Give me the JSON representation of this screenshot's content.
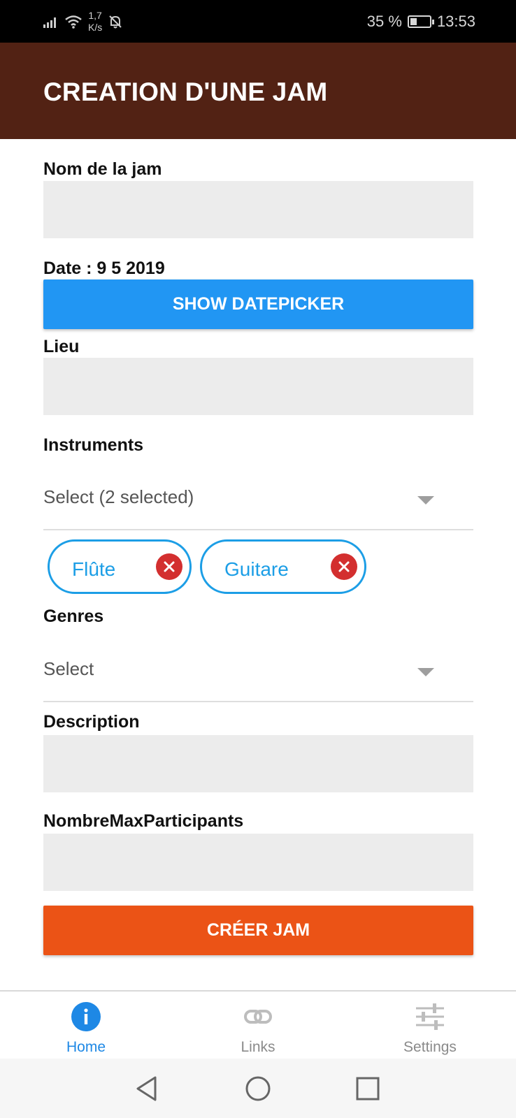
{
  "status_bar": {
    "network_speed_value": "1,7",
    "network_speed_unit": "K/s",
    "battery_percent": "35 %",
    "battery_level": 0.35,
    "time": "13:53"
  },
  "app_bar": {
    "title": "CREATION D'UNE JAM"
  },
  "form": {
    "name": {
      "label": "Nom de la jam",
      "value": ""
    },
    "date": {
      "label": "Date : 9 5 2019"
    },
    "datepicker_button": "SHOW DATEPICKER",
    "lieu": {
      "label": "Lieu",
      "value": ""
    },
    "instruments": {
      "label": "Instruments",
      "select_text": "Select (2 selected)",
      "chips": [
        "Flûte",
        "Guitare"
      ]
    },
    "genres": {
      "label": "Genres",
      "select_text": "Select"
    },
    "description": {
      "label": "Description",
      "value": ""
    },
    "max_participants": {
      "label": "NombreMaxParticipants",
      "value": ""
    },
    "submit_button": "CRÉER JAM"
  },
  "bottom_nav": {
    "items": [
      {
        "label": "Home",
        "icon": "info-icon",
        "active": true
      },
      {
        "label": "Links",
        "icon": "link-icon",
        "active": false
      },
      {
        "label": "Settings",
        "icon": "sliders-icon",
        "active": false
      }
    ]
  },
  "colors": {
    "app_bar": "#522214",
    "datepicker_button": "#2196f3",
    "create_button": "#eb5316",
    "chip": "#1c9ee6",
    "chip_remove": "#d32f2f",
    "nav_active": "#1e88e5"
  }
}
